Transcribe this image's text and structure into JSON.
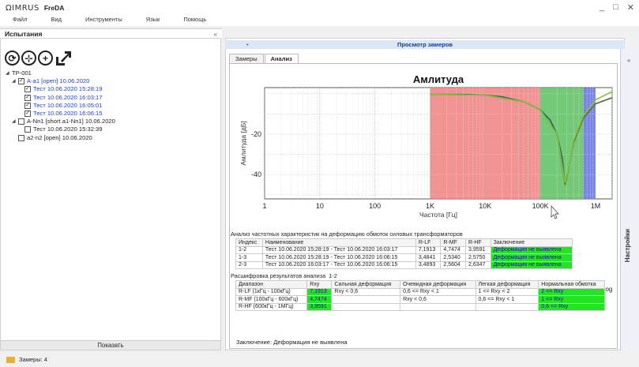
{
  "app": {
    "logo": "ΩIMRUS",
    "name": "FreDA",
    "min": "_",
    "max": "□",
    "close": "✕"
  },
  "menu": [
    "Файл",
    "Вид",
    "Инструменты",
    "Язык",
    "Помощь"
  ],
  "left": {
    "title": "Испытания",
    "collapse": "«",
    "show_button": "Показать",
    "tree": [
      {
        "text": "TP-001",
        "level": 0,
        "expand": "◢",
        "cb": null,
        "blue": false
      },
      {
        "text": "A-a1 [open] 10.06.2020",
        "level": 1,
        "expand": "◢",
        "cb": true,
        "blue": true
      },
      {
        "text": "Тест 10.06.2020 15:28:19",
        "level": 2,
        "expand": "",
        "cb": true,
        "blue": true
      },
      {
        "text": "Тест 10.06.2020 16:03:17",
        "level": 2,
        "expand": "",
        "cb": true,
        "blue": true
      },
      {
        "text": "Тест 10.06.2020 16:05:01",
        "level": 2,
        "expand": "",
        "cb": true,
        "blue": true
      },
      {
        "text": "Тест 10.06.2020 16:06:15",
        "level": 2,
        "expand": "",
        "cb": true,
        "blue": true
      },
      {
        "text": "A-Nn1 [short a1-Nn1] 10.06.2020",
        "level": 1,
        "expand": "◢",
        "cb": false,
        "blue": false
      },
      {
        "text": "Тест 10.06.2020 15:32:39",
        "level": 2,
        "expand": "",
        "cb": false,
        "blue": false
      },
      {
        "text": "a2-n2 [open] 10.06.2020",
        "level": 1,
        "expand": "",
        "cb": false,
        "blue": false
      }
    ]
  },
  "right": {
    "title": "Просмотр замеров",
    "tabs": [
      "Замеры",
      "Анализ"
    ],
    "settings": "Настройки",
    "collapse": "«"
  },
  "chart_data": {
    "type": "line",
    "title": "Амлитуда",
    "xlabel": "Частота [Гц]",
    "ylabel": "Амлитуда [дБ]",
    "xscale": "log",
    "xlim": [
      1,
      2000000
    ],
    "ylim": [
      -52,
      3
    ],
    "xticks": [
      "1",
      "10",
      "100",
      "1K",
      "10K",
      "100K",
      "1M"
    ],
    "yticks": [
      "-20",
      "-40"
    ],
    "bands": [
      {
        "name": "R-LF",
        "from": 1000,
        "to": 100000,
        "color": "#f08080"
      },
      {
        "name": "R-MF",
        "from": 100000,
        "to": 600000,
        "color": "#5cc060"
      },
      {
        "name": "R-HF",
        "from": 600000,
        "to": 1000000,
        "color": "#6070e0"
      }
    ],
    "series": [
      {
        "color": "#2e5f5f",
        "x": [
          1000,
          5000,
          10000,
          20000,
          50000,
          100000,
          150000,
          200000,
          250000,
          280000,
          320000,
          400000,
          600000,
          1000000,
          2000000
        ],
        "y": [
          -0.3,
          -0.4,
          -0.7,
          -1.5,
          -4,
          -8,
          -13,
          -20,
          -32,
          -45,
          -38,
          -24,
          -12,
          -5,
          -2
        ]
      },
      {
        "color": "#6c6c30",
        "x": [
          1000,
          10000,
          50000,
          100000,
          200000,
          280000,
          320000,
          400000,
          600000,
          1000000,
          2000000
        ],
        "y": [
          -0.3,
          -0.7,
          -4,
          -8,
          -20,
          -45,
          -38,
          -24,
          -12,
          -5,
          -2
        ]
      },
      {
        "color": "#80c040",
        "x": [
          1000,
          10000,
          50000,
          100000,
          200000,
          280000,
          330000,
          400000,
          600000,
          1000000,
          2000000
        ],
        "y": [
          -0.3,
          -0.7,
          -4,
          -8,
          -20,
          -44,
          -36,
          -23,
          -11,
          -3,
          1
        ]
      }
    ],
    "log_label": "Log",
    "log_checked": true
  },
  "analysis": {
    "caption": "Анализ частотных характеристик на деформацию обмоток силовых трансформаторов",
    "headers": [
      "Индекс",
      "Наименование",
      "R-LF",
      "R-MF",
      "R-HF",
      "Заключение"
    ],
    "rows": [
      [
        "1-2",
        "Тест 10.06.2020 15:28:19 - Тест 10.06.2020 16:03:17",
        "7,1913",
        "4,7474",
        "3,9591",
        "Деформация не выявлена"
      ],
      [
        "1-3",
        "Тест 10.06.2020 15:28:19 - Тест 10.06.2020 16:06:15",
        "3,4841",
        "2,5340",
        "2,5750",
        "Деформация не выявлена"
      ],
      [
        "2-3",
        "Тест 10.06.2020 16:03:17 - Тест 10.06.2020 16:06:15",
        "3,4893",
        "2,5604",
        "2,6347",
        "Деформация не выявлена"
      ]
    ]
  },
  "decode": {
    "caption": "Расшифровка результатов анализа",
    "index": "1-2",
    "headers": [
      "Диапазон",
      "Rxy",
      "Сильная деформация",
      "Очевидная деформация",
      "Легкая деформация",
      "Нормальная обмотка"
    ],
    "rows": [
      [
        "R-LF (1кГц - 100кГц)",
        "7,1913",
        "Rxy < 0,6",
        "0,6 <= Rxy < 1",
        "1 <= Rxy < 2",
        "2 <= Rxy"
      ],
      [
        "R-MF (100кГц - 600кГц)",
        "4,7474",
        "",
        "Rxy < 0,6",
        "0,6 <= Rxy < 1",
        "1 <= Rxy"
      ],
      [
        "R-HF (600кГц - 1МГц)",
        "3,9591",
        "",
        "",
        "",
        "0,6 <= Rxy"
      ]
    ],
    "conclusion": "Заключение: Деформация не выявлена"
  },
  "status": {
    "text": "Замеры: 4"
  }
}
